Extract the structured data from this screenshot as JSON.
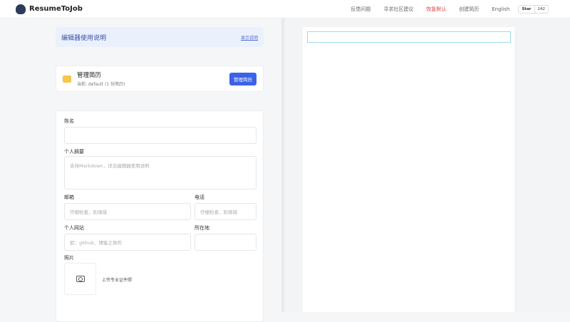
{
  "header": {
    "brand": "ResumeToJob",
    "nav": [
      "反馈问题",
      "寻求社区建议",
      "恢复默认",
      "创建简历",
      "English"
    ],
    "star_label": "Star",
    "star_count": "242",
    "accent_red": "#e0404a"
  },
  "guide": {
    "title": "编辑器使用说明",
    "toggle": "显示说明"
  },
  "manage": {
    "title": "管理简历",
    "subtitle": "当前: default (1 份简历)",
    "button": "管理简历"
  },
  "form": {
    "name_label": "姓名",
    "name_value": "",
    "summary_label": "个人摘要",
    "summary_placeholder": "支持Markdown，详见编辑器使用说明",
    "email_label": "邮箱",
    "email_placeholder": "仔细检查，别填错",
    "phone_label": "电话",
    "phone_placeholder": "仔细检查，别填错",
    "website_label": "个人网站",
    "website_placeholder": "如：github、博客之类的",
    "location_label": "所在地",
    "location_value": "",
    "photo_label": "照片",
    "photo_hint": "上传专业证件照"
  },
  "accent": "#3b63e6"
}
